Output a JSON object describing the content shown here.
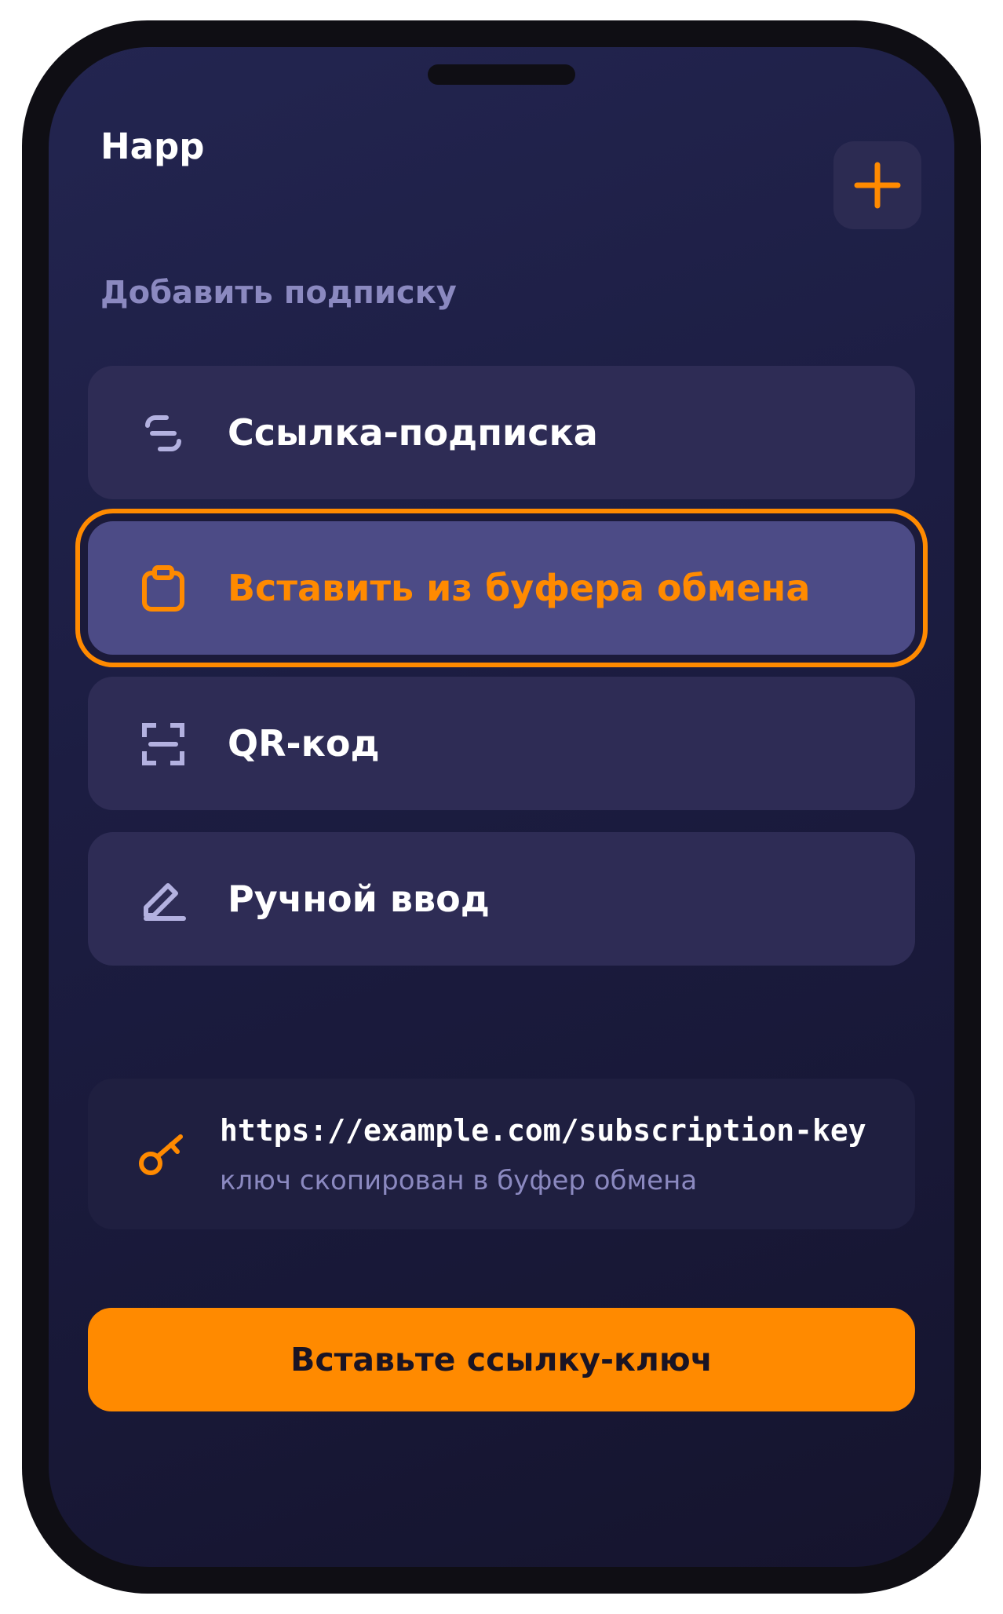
{
  "app": {
    "title": "Happ"
  },
  "header": {
    "add_icon": "plus-icon"
  },
  "section": {
    "title": "Добавить подписку"
  },
  "menu": {
    "items": [
      {
        "label": "Ссылка-подписка",
        "icon": "link-icon",
        "selected": false
      },
      {
        "label": "Вставить из буфера обмена",
        "icon": "clipboard-icon",
        "selected": true
      },
      {
        "label": "QR-код",
        "icon": "qr-scan-icon",
        "selected": false
      },
      {
        "label": "Ручной ввод",
        "icon": "pencil-icon",
        "selected": false
      }
    ]
  },
  "key_card": {
    "url": "https://example.com/subscription-key",
    "note": "ключ скопирован в буфер обмена",
    "icon": "key-icon"
  },
  "primary_button": {
    "label": "Вставьте ссылку-ключ"
  },
  "colors": {
    "accent": "#ff8a00",
    "muted_text": "#8b89c0",
    "icon_lavender": "#b3b1e0",
    "card": "#2e2c55",
    "card_selected": "#4c4b86"
  }
}
